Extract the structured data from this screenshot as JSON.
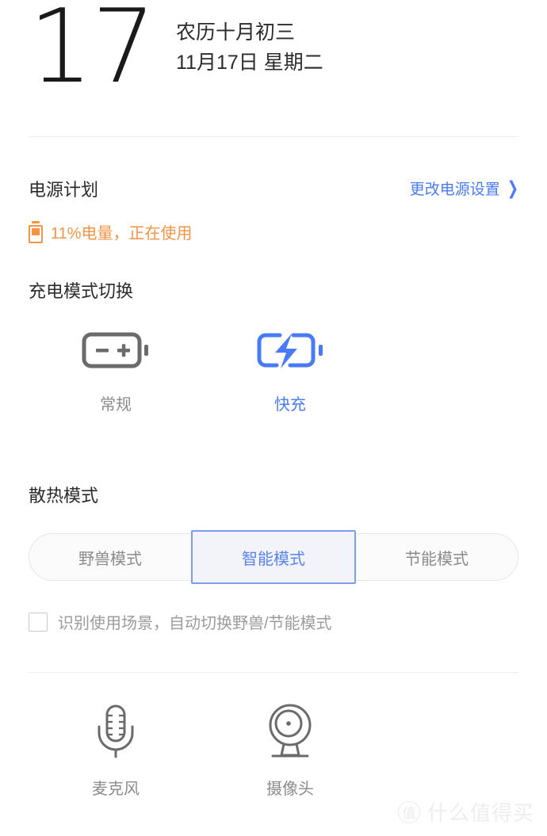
{
  "header": {
    "day_number": "17",
    "lunar_date": "农历十月初三",
    "gregorian_date": "11月17日 星期二"
  },
  "power_plan": {
    "title": "电源计划",
    "change_link": "更改电源设置",
    "chevron": "❯",
    "battery_icon_name": "battery-icon",
    "battery_status": "11%电量，正在使用",
    "battery_percent": "11%",
    "accent_color": "#f59345"
  },
  "charging_mode": {
    "title": "充电模式切换",
    "options": [
      {
        "label": "常规",
        "icon": "battery-plus-minus-icon",
        "selected": false,
        "color": "#8b8b8b"
      },
      {
        "label": "快充",
        "icon": "battery-bolt-icon",
        "selected": true,
        "color": "#4a7bf7"
      }
    ]
  },
  "thermal_mode": {
    "title": "散热模式",
    "segments": [
      {
        "label": "野兽模式",
        "selected": false
      },
      {
        "label": "智能模式",
        "selected": true
      },
      {
        "label": "节能模式",
        "selected": false
      }
    ],
    "selected_color": "#5b83f0",
    "auto_switch": {
      "checked": false,
      "label": "识别使用场景，自动切换野兽/节能模式"
    }
  },
  "devices": [
    {
      "label": "麦克风",
      "icon": "microphone-icon"
    },
    {
      "label": "摄像头",
      "icon": "webcam-icon"
    }
  ],
  "watermark": {
    "badge": "值",
    "text": "什么值得买"
  }
}
